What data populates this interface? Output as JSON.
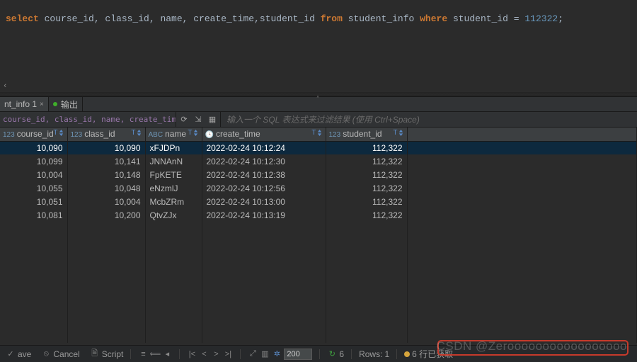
{
  "editor": {
    "sql_select": "select",
    "sql_fields": " course_id, class_id, name, create_time,student_id ",
    "sql_from": "from",
    "sql_table": " student_info ",
    "sql_where": "where",
    "sql_cond_field": " student_id ",
    "sql_eq": "=",
    "sql_value": " 112322",
    "sql_semi": ";"
  },
  "tabs": {
    "result_tab": "nt_info 1",
    "output_tab": "输出"
  },
  "toolbar": {
    "sql_preview_kw": "course_id, class_id, name, create_time,student_id from",
    "filter_hint": "输入一个 SQL 表达式来过滤结果 (使用 Ctrl+Space)"
  },
  "columns": [
    {
      "type": "123",
      "name": "course_id",
      "cls": "c-course",
      "align": "num"
    },
    {
      "type": "123",
      "name": "class_id",
      "cls": "c-class",
      "align": "num"
    },
    {
      "type": "ABC",
      "name": "name",
      "cls": "c-name",
      "align": "txt"
    },
    {
      "type": "",
      "name": "create_time",
      "cls": "c-create",
      "align": "txt",
      "clock": true
    },
    {
      "type": "123",
      "name": "student_id",
      "cls": "c-student",
      "align": "num"
    }
  ],
  "rows": [
    {
      "course_id": "10,090",
      "class_id": "10,090",
      "name": "xFJDPn",
      "create_time": "2022-02-24 10:12:24",
      "student_id": "112,322",
      "selected": true
    },
    {
      "course_id": "10,099",
      "class_id": "10,141",
      "name": "JNNAnN",
      "create_time": "2022-02-24 10:12:30",
      "student_id": "112,322"
    },
    {
      "course_id": "10,004",
      "class_id": "10,148",
      "name": "FpKETE",
      "create_time": "2022-02-24 10:12:38",
      "student_id": "112,322"
    },
    {
      "course_id": "10,055",
      "class_id": "10,048",
      "name": "eNzmlJ",
      "create_time": "2022-02-24 10:12:56",
      "student_id": "112,322"
    },
    {
      "course_id": "10,051",
      "class_id": "10,004",
      "name": "McbZRm",
      "create_time": "2022-02-24 10:13:00",
      "student_id": "112,322"
    },
    {
      "course_id": "10,081",
      "class_id": "10,200",
      "name": "QtvZJx",
      "create_time": "2022-02-24 10:13:19",
      "student_id": "112,322"
    }
  ],
  "status": {
    "save": "ave",
    "cancel": "Cancel",
    "script": "Script",
    "fetch_size": "200",
    "refresh_count": "6",
    "rows_label": "Rows:",
    "rows_value": "1",
    "fetched_label": "6 行已获取"
  },
  "watermark": "CSDN @Zerooooooooooooooooo"
}
